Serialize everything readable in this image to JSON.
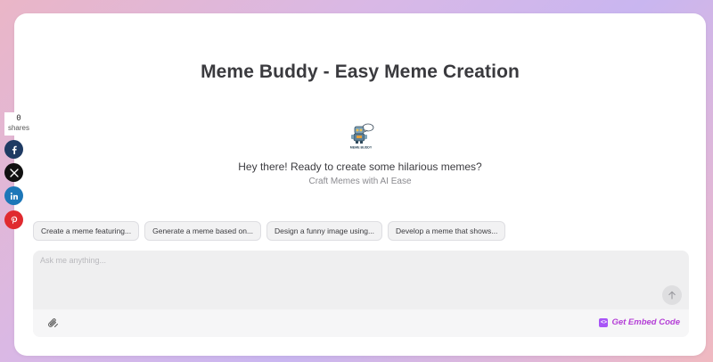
{
  "header": {
    "title": "Meme Buddy - Easy Meme Creation"
  },
  "bot": {
    "logo_text": "MEME BUDDY",
    "greeting": "Hey there! Ready to create some hilarious memes?",
    "tagline": "Craft Memes with AI Ease"
  },
  "suggestions": [
    {
      "label": "Create a meme featuring..."
    },
    {
      "label": "Generate a meme based on..."
    },
    {
      "label": "Design a funny image using..."
    },
    {
      "label": "Develop a meme that shows..."
    }
  ],
  "composer": {
    "placeholder": "Ask me anything...",
    "embed_label": "Get Embed Code"
  },
  "share": {
    "count": "0",
    "label": "shares",
    "buttons": [
      {
        "icon": "facebook-icon",
        "color": "#1f3b63"
      },
      {
        "icon": "x-icon",
        "color": "#111111"
      },
      {
        "icon": "linkedin-icon",
        "color": "#1d77b8"
      },
      {
        "icon": "pinterest-icon",
        "color": "#e02a2f"
      }
    ]
  },
  "colors": {
    "accent": "#b43fd6",
    "composer_bg": "#efeff0"
  }
}
